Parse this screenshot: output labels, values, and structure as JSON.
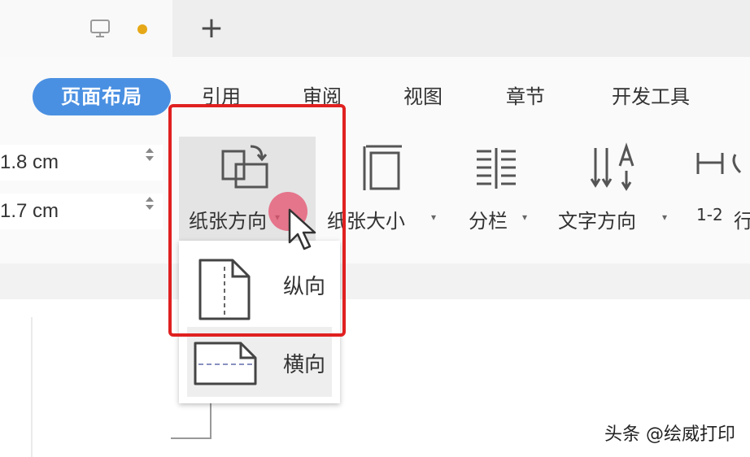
{
  "tabbar": {
    "screen_icon": "monitor-icon",
    "status_color": "#e6a817",
    "new_tab_symbol": "+"
  },
  "menu": {
    "tabs": [
      "页面布局",
      "引用",
      "审阅",
      "视图",
      "章节",
      "开发工具"
    ],
    "active_tab": "页面布局",
    "active_color": "#4a90e2"
  },
  "margins": {
    "value1": "1.8 cm",
    "value2": "1.7 cm"
  },
  "tools": {
    "orientation": "纸张方向",
    "size": "纸张大小",
    "columns": "分栏",
    "text_direction": "文字方向",
    "hyphen_glyph": "1-2",
    "partial_char": "行"
  },
  "orientation_menu": {
    "portrait": "纵向",
    "landscape": "横向"
  },
  "highlight_color": "#e02020",
  "watermark": "头条 @绘威打印"
}
